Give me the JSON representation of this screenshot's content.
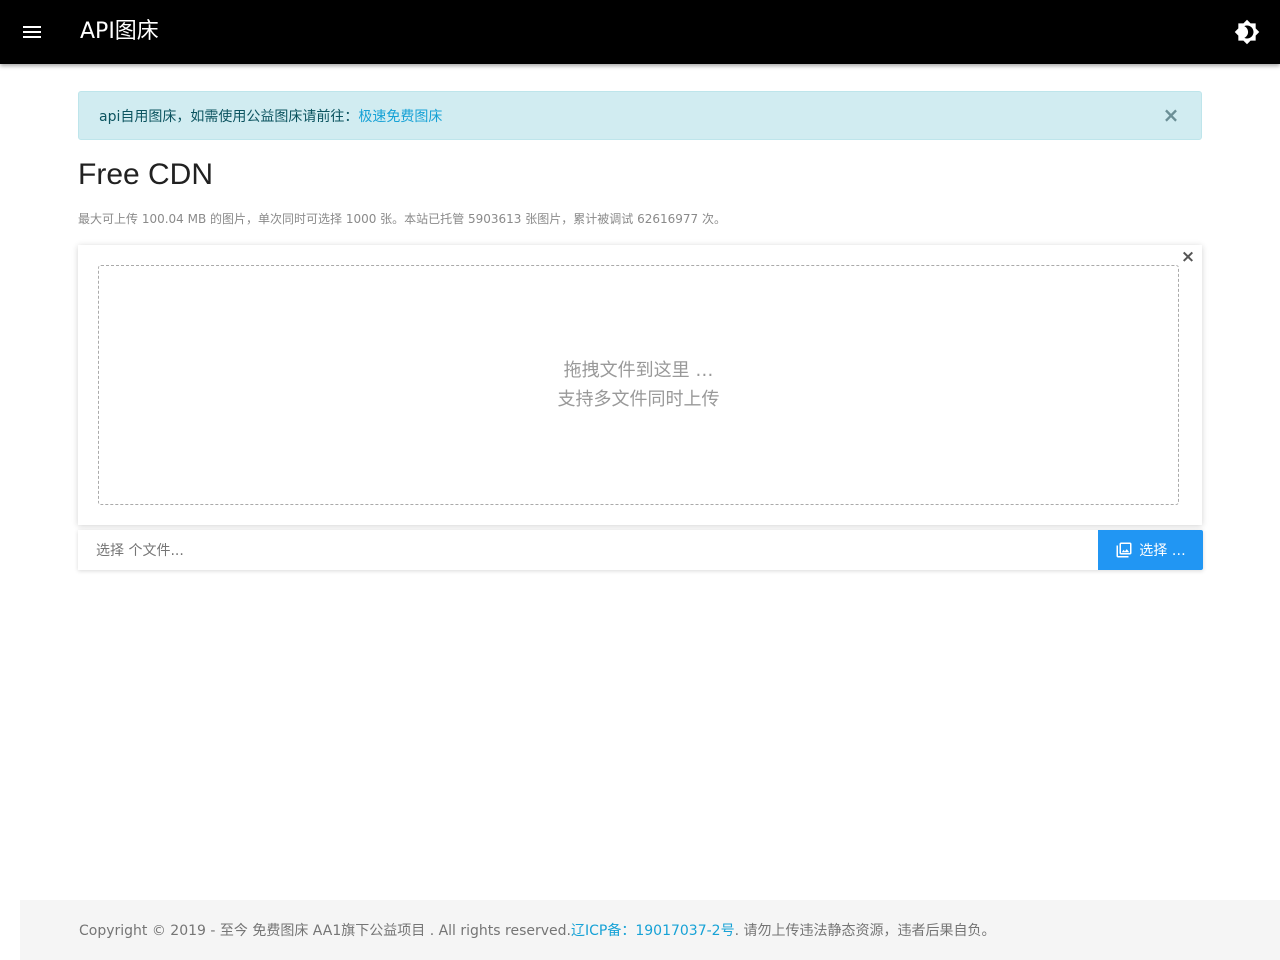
{
  "header": {
    "title": "API图床",
    "menu_icon": "menu-icon",
    "theme_icon": "brightness-icon"
  },
  "alert": {
    "text": "api自用图床，如需使用公益图床请前往：",
    "link_text": "极速免费图床",
    "close_label": "×"
  },
  "main": {
    "title": "Free CDN",
    "subtitle": "最大可上传 100.04 MB 的图片，单次同时可选择 1000 张。本站已托管 5903613 张图片，累计被调试 62616977 次。",
    "card_close_label": "×",
    "drop_line1": "拖拽文件到这里 …",
    "drop_line2": "支持多文件同时上传",
    "file_caption": "选择 个文件...",
    "browse_label": "选择 …"
  },
  "footer": {
    "copyright": "Copyright © 2019 - 至今 免费图床 AA1旗下公益项目 . All rights reserved. ",
    "icp_link": "辽ICP备：19017037-2号",
    "notice": ". 请勿上传违法静态资源，违者后果自负。"
  },
  "colors": {
    "appbar": "#000000",
    "alert_bg": "#d1ecf1",
    "link": "#17a2d6",
    "primary": "#2196f3",
    "footer_bg": "#f5f5f5"
  }
}
